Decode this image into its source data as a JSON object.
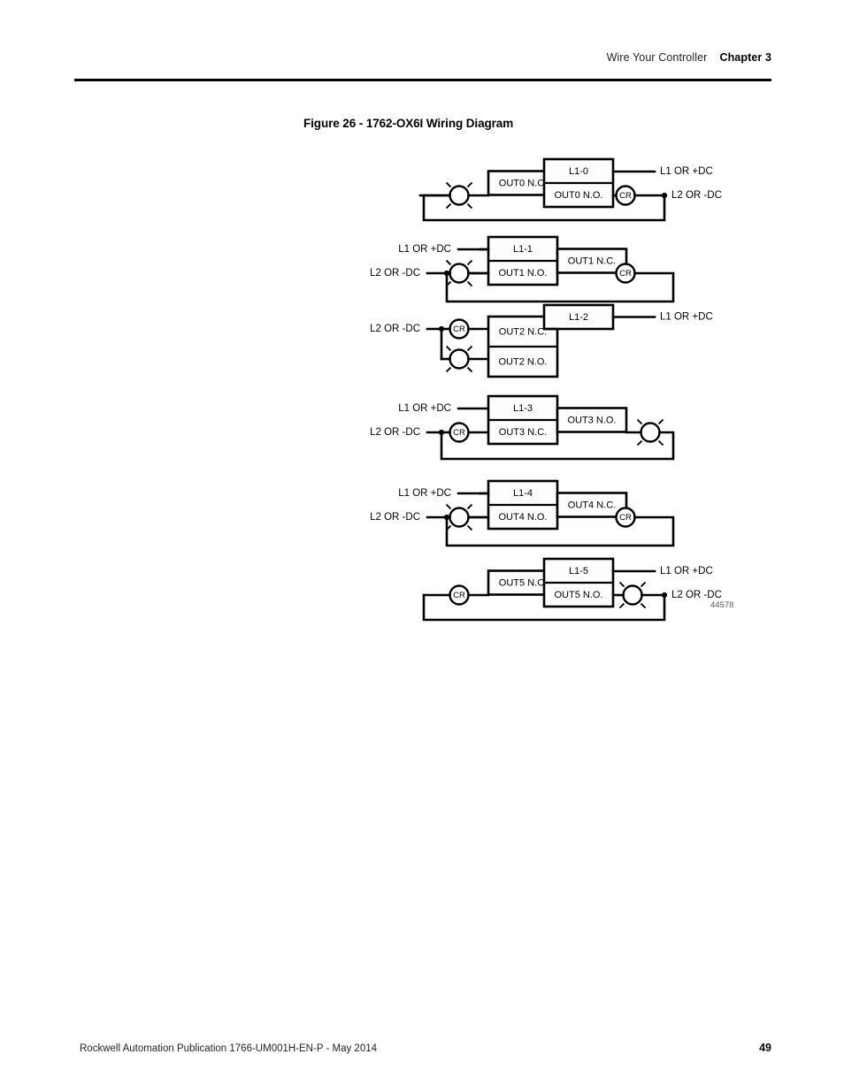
{
  "header": {
    "section": "Wire Your Controller",
    "chapter": "Chapter 3"
  },
  "figure": {
    "caption": "Figure 26 - 1762-OX6I Wiring Diagram",
    "drawing_id": "44578"
  },
  "footer": {
    "publication": "Rockwell Automation Publication 1766-UM001H-EN-P - May 2014",
    "page_number": "49"
  },
  "labels": {
    "l1": "L1 OR +DC",
    "l2": "L2 OR -DC",
    "relay": "CR"
  },
  "circuits": [
    {
      "id": "circuit-0",
      "terminal": "L1-0",
      "nc": "OUT0 N.C.",
      "no": "OUT0 N.O.",
      "layout": "lamp-left-relay-right",
      "l1_position": "right",
      "l2_position": "right"
    },
    {
      "id": "circuit-1",
      "terminal": "L1-1",
      "nc": "OUT1 N.C.",
      "no": "OUT1 N.O.",
      "layout": "lamp-left-relay-right",
      "l1_position": "left",
      "l2_position": "left"
    },
    {
      "id": "circuit-2",
      "terminal": "L1-2",
      "nc": "OUT2 N.C.",
      "no": "OUT2 N.O.",
      "layout": "relay-and-lamp-left",
      "l1_position": "right",
      "l2_position": "left"
    },
    {
      "id": "circuit-3",
      "terminal": "L1-3",
      "nc": "OUT3 N.C.",
      "no": "OUT3 N.O.",
      "layout": "relay-left-lamp-right",
      "l1_position": "left",
      "l2_position": "left"
    },
    {
      "id": "circuit-4",
      "terminal": "L1-4",
      "nc": "OUT4 N.C.",
      "no": "OUT4 N.O.",
      "layout": "lamp-left-relay-right",
      "l1_position": "left",
      "l2_position": "left"
    },
    {
      "id": "circuit-5",
      "terminal": "L1-5",
      "nc": "OUT5 N.C.",
      "no": "OUT5 N.O.",
      "layout": "relay-left-lamp-right",
      "l1_position": "right",
      "l2_position": "right"
    }
  ]
}
